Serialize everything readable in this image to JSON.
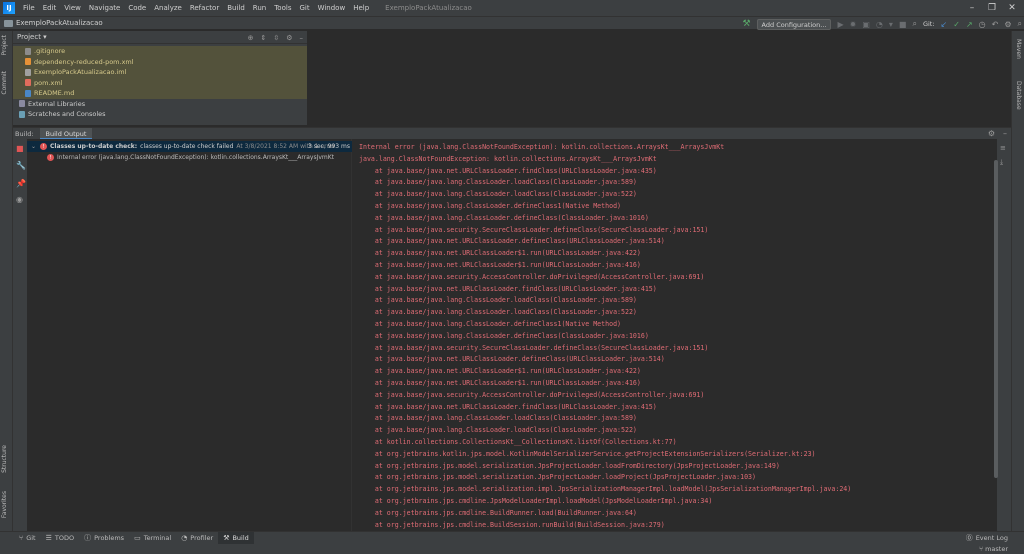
{
  "menu": {
    "items": [
      "File",
      "Edit",
      "View",
      "Navigate",
      "Code",
      "Analyze",
      "Refactor",
      "Build",
      "Run",
      "Tools",
      "Git",
      "Window",
      "Help"
    ],
    "project_title": "ExemploPackAtualizacao"
  },
  "navbar": {
    "project": "ExemploPackAtualizacao",
    "add_configuration": "Add Configuration...",
    "git_label": "Git:"
  },
  "left_stripe": {
    "project_tab": "Project",
    "commit_tab": "Commit",
    "structure_tab": "Structure",
    "favorites_tab": "Favorites"
  },
  "right_stripe": {
    "maven_tab": "Maven",
    "database_tab": "Database"
  },
  "project_panel": {
    "dropdown": "Project ▾",
    "items": [
      {
        "label": ".gitignore",
        "color": "#8c8c8c"
      },
      {
        "label": "dependency-reduced-pom.xml",
        "color": "#e59137"
      },
      {
        "label": "ExemploPackAtualizacao.iml",
        "color": "#a0a0a0"
      },
      {
        "label": "pom.xml",
        "color": "#e06c5c"
      },
      {
        "label": "README.md",
        "color": "#4a88c7"
      },
      {
        "label": "External Libraries",
        "color": "#8a8aa0"
      },
      {
        "label": "Scratches and Consoles",
        "color": "#6a9fb5"
      }
    ]
  },
  "build": {
    "label": "Build:",
    "tab": "Build Output",
    "row1_bold": "Classes up-to-date check:",
    "row1_text": "classes up-to-date check failed",
    "row1_meta": "At 3/8/2021 8:52 AM with 1 error",
    "row1_time": "3 sec, 993 ms",
    "row2_text": "Internal error (java.lang.ClassNotFoundException): kotlin.collections.ArraysKt___ArraysJvmKt"
  },
  "console_lines": [
    "Internal error (java.lang.ClassNotFoundException): kotlin.collections.ArraysKt___ArraysJvmKt",
    "java.lang.ClassNotFoundException: kotlin.collections.ArraysKt___ArraysJvmKt",
    "    at java.base/java.net.URLClassLoader.findClass(URLClassLoader.java:435)",
    "    at java.base/java.lang.ClassLoader.loadClass(ClassLoader.java:589)",
    "    at java.base/java.lang.ClassLoader.loadClass(ClassLoader.java:522)",
    "    at java.base/java.lang.ClassLoader.defineClass1(Native Method)",
    "    at java.base/java.lang.ClassLoader.defineClass(ClassLoader.java:1016)",
    "    at java.base/java.security.SecureClassLoader.defineClass(SecureClassLoader.java:151)",
    "    at java.base/java.net.URLClassLoader.defineClass(URLClassLoader.java:514)",
    "    at java.base/java.net.URLClassLoader$1.run(URLClassLoader.java:422)",
    "    at java.base/java.net.URLClassLoader$1.run(URLClassLoader.java:416)",
    "    at java.base/java.security.AccessController.doPrivileged(AccessController.java:691)",
    "    at java.base/java.net.URLClassLoader.findClass(URLClassLoader.java:415)",
    "    at java.base/java.lang.ClassLoader.loadClass(ClassLoader.java:589)",
    "    at java.base/java.lang.ClassLoader.loadClass(ClassLoader.java:522)",
    "    at java.base/java.lang.ClassLoader.defineClass1(Native Method)",
    "    at java.base/java.lang.ClassLoader.defineClass(ClassLoader.java:1016)",
    "    at java.base/java.security.SecureClassLoader.defineClass(SecureClassLoader.java:151)",
    "    at java.base/java.net.URLClassLoader.defineClass(URLClassLoader.java:514)",
    "    at java.base/java.net.URLClassLoader$1.run(URLClassLoader.java:422)",
    "    at java.base/java.net.URLClassLoader$1.run(URLClassLoader.java:416)",
    "    at java.base/java.security.AccessController.doPrivileged(AccessController.java:691)",
    "    at java.base/java.net.URLClassLoader.findClass(URLClassLoader.java:415)",
    "    at java.base/java.lang.ClassLoader.loadClass(ClassLoader.java:589)",
    "    at java.base/java.lang.ClassLoader.loadClass(ClassLoader.java:522)",
    "    at kotlin.collections.CollectionsKt__CollectionsKt.listOf(Collections.kt:77)",
    "    at org.jetbrains.kotlin.jps.model.KotlinModelSerializerService.getProjectExtensionSerializers(Serializer.kt:23)",
    "    at org.jetbrains.jps.model.serialization.JpsProjectLoader.loadFromDirectory(JpsProjectLoader.java:149)",
    "    at org.jetbrains.jps.model.serialization.JpsProjectLoader.loadProject(JpsProjectLoader.java:103)",
    "    at org.jetbrains.jps.model.serialization.impl.JpsSerializationManagerImpl.loadModel(JpsSerializationManagerImpl.java:24)",
    "    at org.jetbrains.jps.cmdline.JpsModelLoaderImpl.loadModel(JpsModelLoaderImpl.java:34)",
    "    at org.jetbrains.jps.cmdline.BuildRunner.load(BuildRunner.java:64)",
    "    at org.jetbrains.jps.cmdline.BuildSession.runBuild(BuildSession.java:279)"
  ],
  "bottom_bar": {
    "items": [
      "Git",
      "TODO",
      "Problems",
      "Terminal",
      "Profiler",
      "Build"
    ],
    "active": "Build",
    "event_log": "Event Log"
  },
  "status": {
    "branch": "master"
  }
}
